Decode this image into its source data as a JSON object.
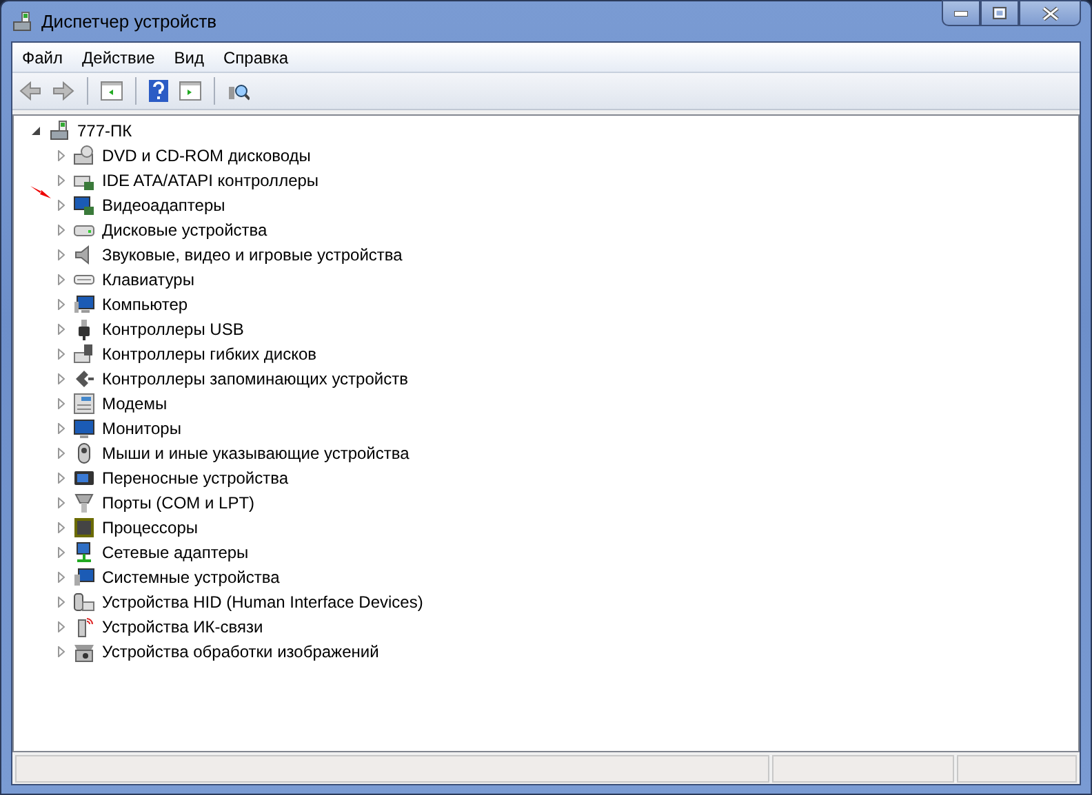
{
  "window": {
    "title": "Диспетчер устройств"
  },
  "menu": [
    "Файл",
    "Действие",
    "Вид",
    "Справка"
  ],
  "toolbar": [
    {
      "kind": "back"
    },
    {
      "kind": "forward"
    },
    {
      "kind": "sep"
    },
    {
      "kind": "tree"
    },
    {
      "kind": "sep"
    },
    {
      "kind": "help"
    },
    {
      "kind": "pane"
    },
    {
      "kind": "sep"
    },
    {
      "kind": "scan"
    }
  ],
  "tree": [
    {
      "label": "777-ПК",
      "expanded": true,
      "children": [
        {
          "label": "DVD и CD-ROM дисководы",
          "expanded": false
        },
        {
          "label": "IDE ATA/ATAPI контроллеры",
          "expanded": false
        },
        {
          "label": "Видеоадаптеры",
          "expanded": false
        },
        {
          "label": "Дисковые устройства",
          "expanded": false
        },
        {
          "label": "Звуковые, видео и игровые устройства",
          "expanded": false
        },
        {
          "label": "Клавиатуры",
          "expanded": false
        },
        {
          "label": "Компьютер",
          "expanded": false
        },
        {
          "label": "Контроллеры USB",
          "expanded": false
        },
        {
          "label": "Контроллеры гибких дисков",
          "expanded": false
        },
        {
          "label": "Контроллеры запоминающих устройств",
          "expanded": false
        },
        {
          "label": "Модемы",
          "expanded": false
        },
        {
          "label": "Мониторы",
          "expanded": false
        },
        {
          "label": "Мыши и иные указывающие устройства",
          "expanded": false
        },
        {
          "label": "Переносные устройства",
          "expanded": false
        },
        {
          "label": "Порты (COM и LPT)",
          "expanded": false
        },
        {
          "label": "Процессоры",
          "expanded": false
        },
        {
          "label": "Сетевые адаптеры",
          "expanded": false
        },
        {
          "label": "Системные устройства",
          "expanded": false
        },
        {
          "label": "Устройства HID (Human Interface Devices)",
          "expanded": false
        },
        {
          "label": "Устройства ИК-связи",
          "expanded": false
        },
        {
          "label": "Устройства обработки изображений",
          "expanded": false
        }
      ]
    }
  ]
}
